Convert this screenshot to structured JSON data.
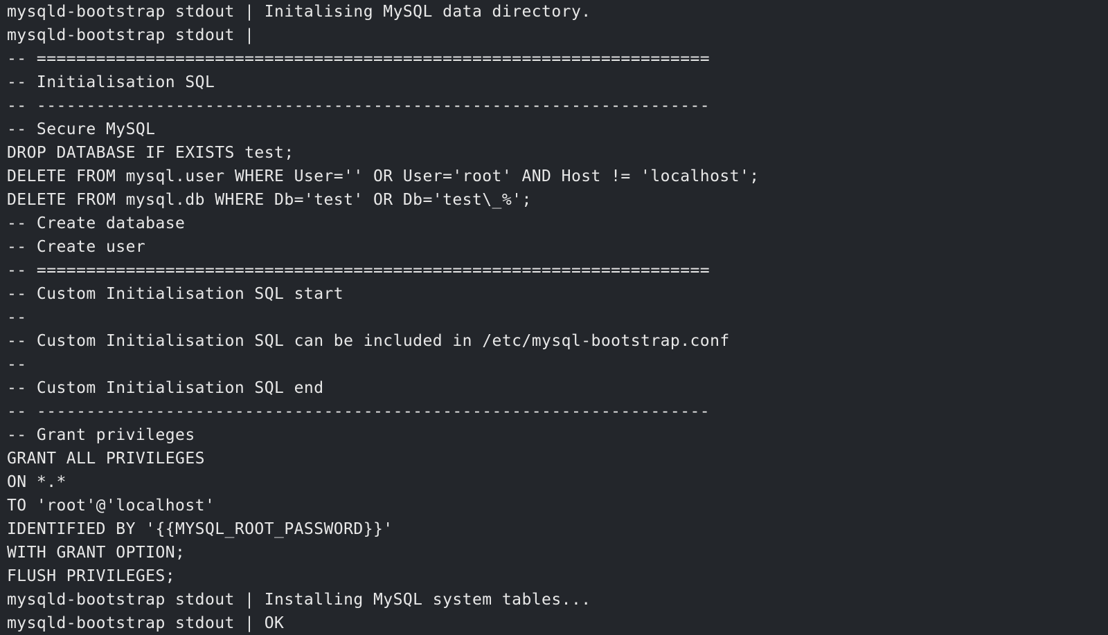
{
  "terminal": {
    "lines": [
      "mysqld-bootstrap stdout | Initalising MySQL data directory.",
      "mysqld-bootstrap stdout |",
      "-- ====================================================================",
      "-- Initialisation SQL",
      "-- --------------------------------------------------------------------",
      "-- Secure MySQL",
      "DROP DATABASE IF EXISTS test;",
      "DELETE FROM mysql.user WHERE User='' OR User='root' AND Host != 'localhost';",
      "DELETE FROM mysql.db WHERE Db='test' OR Db='test\\_%';",
      "-- Create database",
      "-- Create user",
      "-- ====================================================================",
      "-- Custom Initialisation SQL start",
      "--",
      "-- Custom Initialisation SQL can be included in /etc/mysql-bootstrap.conf",
      "--",
      "-- Custom Initialisation SQL end",
      "-- --------------------------------------------------------------------",
      "-- Grant privileges",
      "GRANT ALL PRIVILEGES",
      "ON *.*",
      "TO 'root'@'localhost'",
      "IDENTIFIED BY '{{MYSQL_ROOT_PASSWORD}}'",
      "WITH GRANT OPTION;",
      "FLUSH PRIVILEGES;",
      "mysqld-bootstrap stdout | Installing MySQL system tables...",
      "mysqld-bootstrap stdout | OK"
    ]
  },
  "colors": {
    "background": "#23262b",
    "text": "#e8e8e8"
  }
}
